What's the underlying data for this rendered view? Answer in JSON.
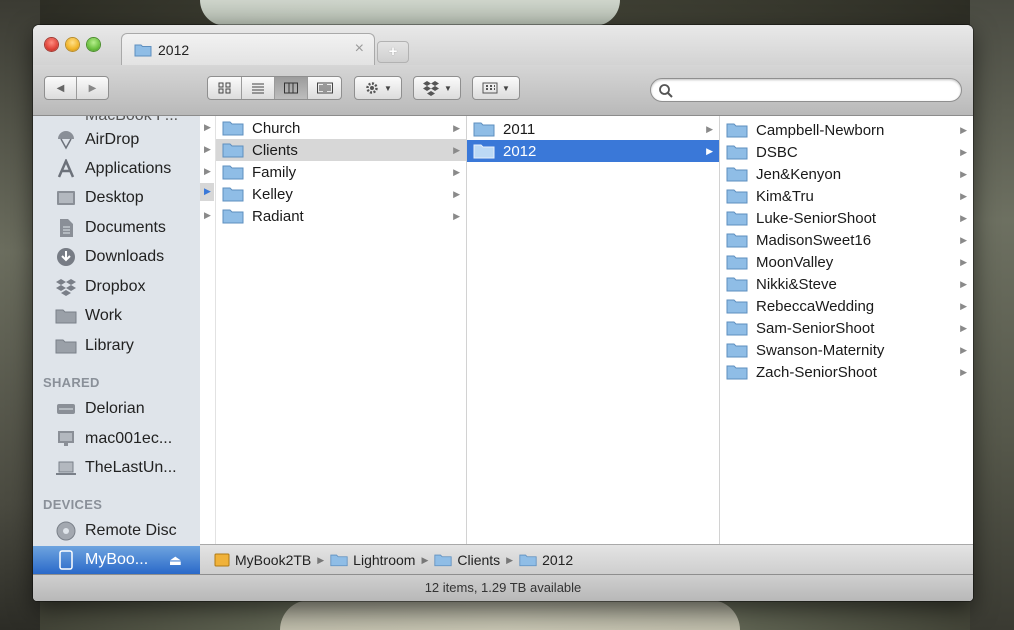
{
  "window": {
    "tab_title": "2012",
    "tab_close": "×",
    "new_tab": "+"
  },
  "toolbar": {
    "back": "◀",
    "forward": "▶",
    "search_placeholder": ""
  },
  "sidebar": {
    "top_partial": "MacBook P...",
    "favorites": [
      {
        "label": "AirDrop",
        "icon": "airdrop-icon"
      },
      {
        "label": "Applications",
        "icon": "applications-icon"
      },
      {
        "label": "Desktop",
        "icon": "desktop-icon"
      },
      {
        "label": "Documents",
        "icon": "documents-icon"
      },
      {
        "label": "Downloads",
        "icon": "downloads-icon"
      },
      {
        "label": "Dropbox",
        "icon": "dropbox-icon"
      },
      {
        "label": "Work",
        "icon": "folder-icon"
      },
      {
        "label": "Library",
        "icon": "folder-icon"
      }
    ],
    "shared_header": "SHARED",
    "shared": [
      {
        "label": "Delorian",
        "icon": "server-icon"
      },
      {
        "label": "mac001ec...",
        "icon": "imac-icon"
      },
      {
        "label": "TheLastUn...",
        "icon": "laptop-icon"
      }
    ],
    "devices_header": "DEVICES",
    "devices": [
      {
        "label": "Remote Disc",
        "icon": "disc-icon"
      },
      {
        "label": "MyBoo...",
        "icon": "external-drive-icon"
      }
    ]
  },
  "columns": {
    "col1": [
      "Church",
      "Clients",
      "Family",
      "Kelley",
      "Radiant"
    ],
    "col2": [
      "2011",
      "2012"
    ],
    "col3": [
      "Campbell-Newborn",
      "DSBC",
      "Jen&Kenyon",
      "Kim&Tru",
      "Luke-SeniorShoot",
      "MadisonSweet16",
      "MoonValley",
      "Nikki&Steve",
      "RebeccaWedding",
      "Sam-SeniorShoot",
      "Swanson-Maternity",
      "Zach-SeniorShoot"
    ]
  },
  "pathbar": [
    "MyBook2TB",
    "Lightroom",
    "Clients",
    "2012"
  ],
  "status": "12 items, 1.29 TB available",
  "colors": {
    "selection_blue": "#3a78d8",
    "sidebar_bg": "#dfe4ea",
    "folder_blue": "#8fbde6"
  }
}
